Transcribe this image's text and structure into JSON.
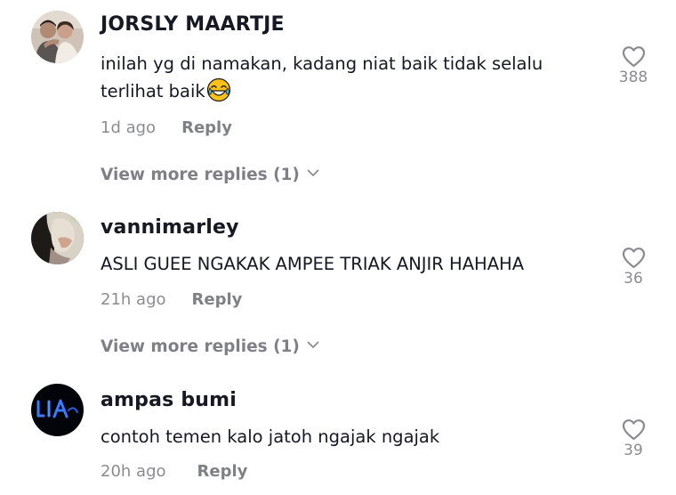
{
  "comments": [
    {
      "username": "JORSLY MAARTJE",
      "text": "inilah yg di namakan, kadang niat baik tidak selalu terlihat baik",
      "emoji": "face-with-tears-of-joy-emoji",
      "time": "1d ago",
      "reply_label": "Reply",
      "likes": "388",
      "view_more": "View more replies (1)"
    },
    {
      "username": "vannimarley",
      "text": "ASLI GUEE NGAKAK AMPEE TRIAK ANJIR HAHAHA",
      "time": "21h ago",
      "reply_label": "Reply",
      "likes": "36",
      "view_more": "View more replies (1)"
    },
    {
      "username": "ampas bumi",
      "text": "contoh temen kalo jatoh ngajak ngajak",
      "time": "20h ago",
      "reply_label": "Reply",
      "likes": "39"
    }
  ],
  "icons": {
    "like": "heart-outline-icon",
    "expand": "chevron-down-icon"
  },
  "colors": {
    "primary_text": "#161823",
    "secondary_text": "#8a8b91",
    "avatar_3_text": "#3a7bff"
  }
}
